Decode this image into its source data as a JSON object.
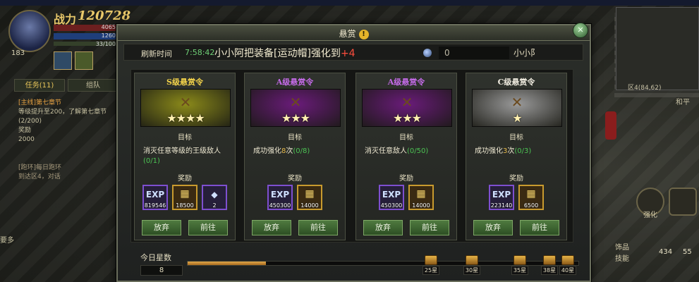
{
  "hud": {
    "power_label": "战力",
    "power_value": "120728",
    "player_level": "183",
    "hp_text": "4065",
    "mp_text": "1260",
    "exp_text": "33/100",
    "tabs": [
      {
        "label": "任务(11)"
      },
      {
        "label": "组队"
      }
    ],
    "quest_title": "[主线]第七章节",
    "quest_desc": "等级提升至200，了解第七章节",
    "quest_progress": "(2/200)",
    "quest_reward_label": "奖励",
    "reward_1_qty": "2000",
    "daily_title": "[跑环]每日跑环",
    "daily_desc": "到达区4，对话",
    "more_label": "要多"
  },
  "right_hud": {
    "coord": "区4(84,62)",
    "peace_mode": "和平",
    "enhance_label": "强化",
    "accessory_label": "饰品",
    "skill_label": "技能",
    "count_left": "434",
    "count_right": "55"
  },
  "modal": {
    "title": "悬赏",
    "title_icon": "!",
    "close_icon": "✕",
    "refresh_label": "刷新时间",
    "refresh_time": "7:58:42",
    "broadcast_text": "小小阿把装备[运动帽]强化到",
    "broadcast_plus": "+4",
    "gem_value": "0",
    "player_name": "小小阝",
    "section_target": "目标",
    "section_reward": "奖励",
    "abandon_label": "放弃",
    "goto_label": "前往",
    "today_stars_label": "今日星数",
    "today_stars_value": "8",
    "today_stars_progress": 0.2
  },
  "cards": [
    {
      "title": "S级悬赏令",
      "title_color": "#f2d24a",
      "banner_color": "#8b8a1a",
      "stars": "★★★★",
      "target": "消灭任意等级的王级敌人",
      "progress": "(0/1)",
      "rewards": [
        {
          "type": "exp",
          "glyph": "EXP",
          "qty": "819546"
        },
        {
          "type": "gold",
          "glyph": "▦",
          "qty": "18500"
        },
        {
          "type": "crystal",
          "glyph": "◆",
          "qty": "2"
        }
      ]
    },
    {
      "title": "A级悬赏令",
      "title_color": "#c46be8",
      "banner_color": "#6a1b7a",
      "stars": "★★★",
      "target": "成功强化",
      "target_num": "8",
      "target_suffix": "次",
      "progress": "(0/8)",
      "rewards": [
        {
          "type": "exp",
          "glyph": "EXP",
          "qty": "450300"
        },
        {
          "type": "gold",
          "glyph": "▦",
          "qty": "14000"
        }
      ]
    },
    {
      "title": "A级悬赏令",
      "title_color": "#c46be8",
      "banner_color": "#6a1b7a",
      "stars": "★★★",
      "target": "消灭任意敌人",
      "progress": "(0/50)",
      "rewards": [
        {
          "type": "exp",
          "glyph": "EXP",
          "qty": "450300"
        },
        {
          "type": "gold",
          "glyph": "▦",
          "qty": "14000"
        }
      ]
    },
    {
      "title": "C级悬赏令",
      "title_color": "#f0ece0",
      "banner_color": "#9a9a9a",
      "stars": "★",
      "target": "成功强化",
      "target_num": "3",
      "target_suffix": "次",
      "progress": "(0/3)",
      "rewards": [
        {
          "type": "exp",
          "glyph": "EXP",
          "qty": "223140"
        },
        {
          "type": "gold",
          "glyph": "▦",
          "qty": "6500"
        }
      ]
    }
  ],
  "chests": [
    {
      "label": "25星"
    },
    {
      "label": "30星"
    },
    {
      "label": "35星"
    },
    {
      "label": "38星"
    },
    {
      "label": "40星"
    }
  ]
}
